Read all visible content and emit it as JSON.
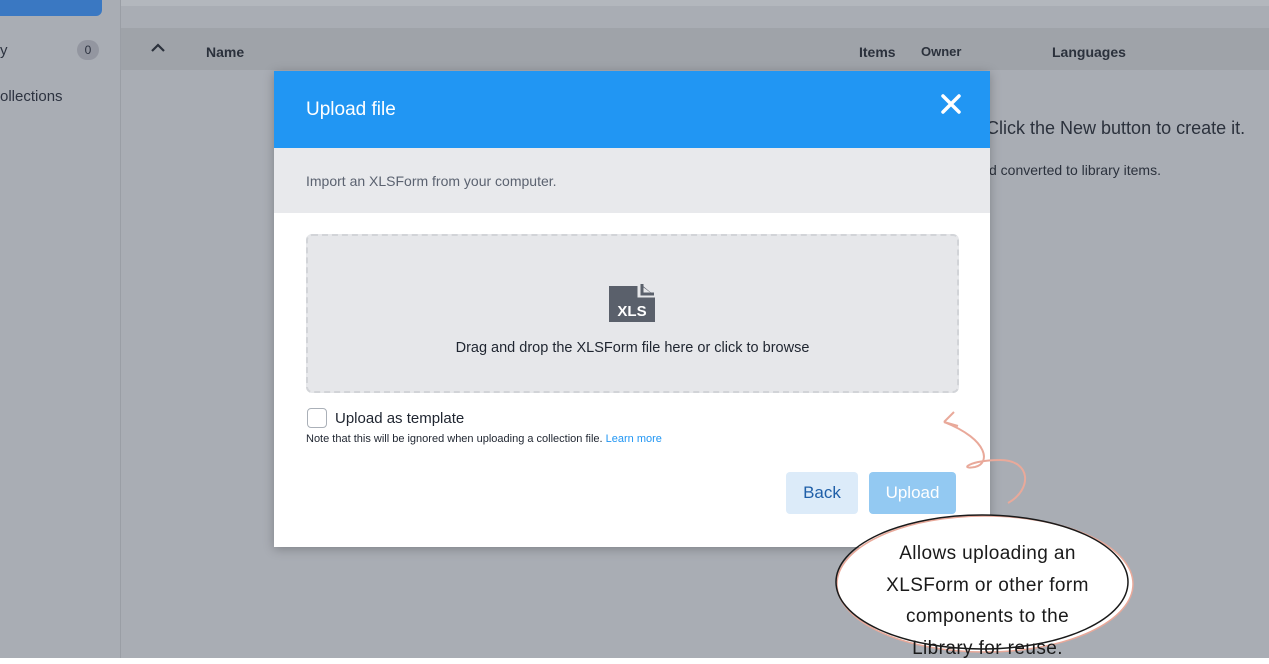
{
  "sidebar": {
    "items": [
      {
        "label": "y",
        "count": "0"
      },
      {
        "label": "ollections"
      }
    ]
  },
  "table": {
    "headers": {
      "name": "Name",
      "items": "Items",
      "owner": "Owner",
      "languages": "Languages"
    }
  },
  "empty_state": {
    "line1": "Click the New button to create it.",
    "line2": "d converted to library items."
  },
  "modal": {
    "title": "Upload file",
    "subtitle": "Import an XLSForm from your computer.",
    "dropzone": {
      "icon_label": "XLS",
      "text": "Drag and drop the XLSForm file here or click to browse"
    },
    "template_checkbox": {
      "label": "Upload as template",
      "checked": false,
      "note": "Note that this will be ignored when uploading a collection file.",
      "learn_more": "Learn more"
    },
    "buttons": {
      "back": "Back",
      "upload": "Upload"
    }
  },
  "callout": {
    "lines": [
      "Allows uploading an",
      "XLSForm or other form",
      "components to the",
      "Library for reuse."
    ]
  },
  "colors": {
    "modal_header": "#2196f3",
    "upload_button": "#93c9f2",
    "back_button": "#dcebf9",
    "annotation_stroke": "#e9a99a",
    "overlay": "#a9adb4"
  }
}
